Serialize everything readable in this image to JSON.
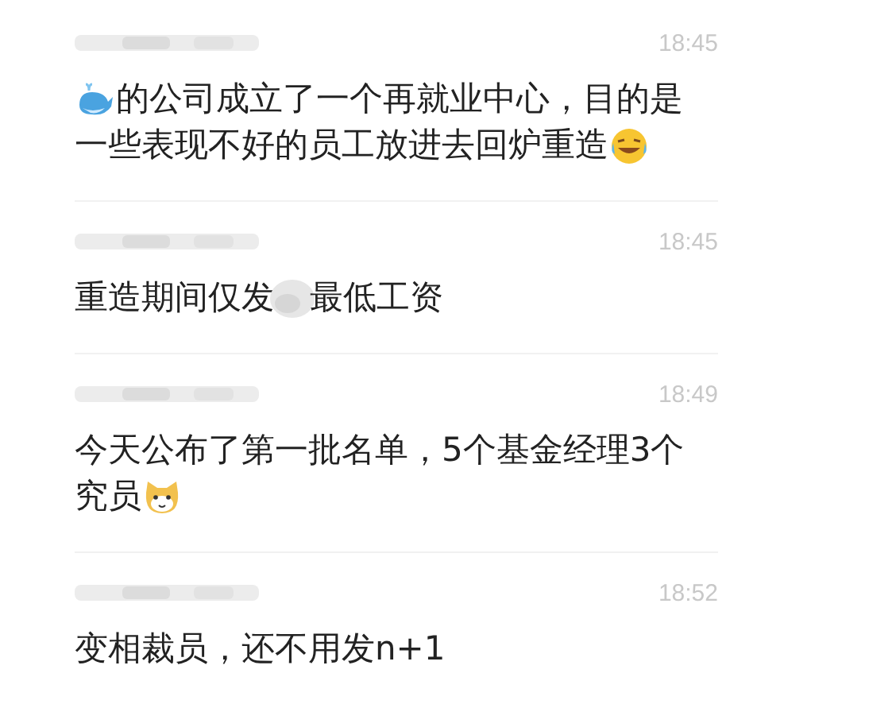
{
  "messages": [
    {
      "time": "18:45",
      "lines": [
        [
          {
            "kind": "whale"
          },
          {
            "kind": "text",
            "text": "的公司成立了一个再就业中心，目的是"
          }
        ],
        [
          {
            "kind": "text",
            "text": "一些表现不好的员工放进去回炉重造"
          },
          {
            "kind": "laugh-cry"
          }
        ]
      ]
    },
    {
      "time": "18:45",
      "lines": [
        [
          {
            "kind": "text",
            "text": "重造期间仅发"
          },
          {
            "kind": "blur"
          },
          {
            "kind": "text",
            "text": "最低工资"
          }
        ]
      ]
    },
    {
      "time": "18:49",
      "lines": [
        [
          {
            "kind": "text",
            "text": "今天公布了第一批名单，5个基金经理3个"
          }
        ],
        [
          {
            "kind": "text",
            "text": "究员"
          },
          {
            "kind": "cat"
          }
        ]
      ]
    },
    {
      "time": "18:52",
      "lines": [
        [
          {
            "kind": "text",
            "text": "变相裁员，还不用发n+1"
          }
        ]
      ]
    }
  ]
}
